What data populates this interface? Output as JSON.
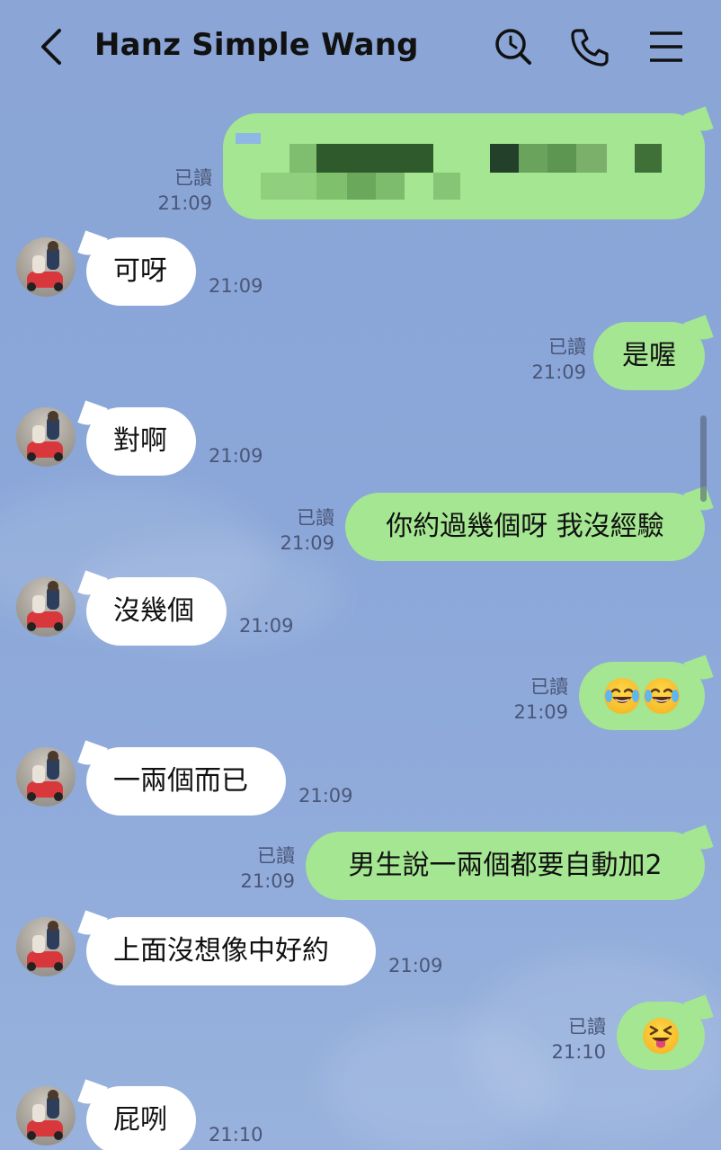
{
  "header": {
    "title": "Hanz Simple Wang",
    "back_icon": "chevron-left-icon",
    "actions": [
      "search-icon",
      "phone-icon",
      "menu-icon"
    ]
  },
  "colors": {
    "background": "#8ba7d9",
    "incoming_bubble": "#ffffff",
    "outgoing_bubble": "#a4e691"
  },
  "messages": [
    {
      "dir": "out",
      "text": "",
      "blurred": true,
      "read": "已讀",
      "time": "21:09"
    },
    {
      "dir": "in",
      "text": "可呀",
      "time": "21:09"
    },
    {
      "dir": "out",
      "text": "是喔",
      "read": "已讀",
      "time": "21:09"
    },
    {
      "dir": "in",
      "text": "對啊",
      "time": "21:09"
    },
    {
      "dir": "out",
      "text": "你約過幾個呀 我沒經驗",
      "read": "已讀",
      "time": "21:09"
    },
    {
      "dir": "in",
      "text": "沒幾個",
      "time": "21:09"
    },
    {
      "dir": "out",
      "text": "",
      "emoji": "tears-of-joy-emoji x2",
      "read": "已讀",
      "time": "21:09"
    },
    {
      "dir": "in",
      "text": "一兩個而已",
      "time": "21:09"
    },
    {
      "dir": "out",
      "text": "男生說一兩個都要自動加2",
      "read": "已讀",
      "time": "21:09"
    },
    {
      "dir": "in",
      "text": "上面沒想像中好約",
      "time": "21:09"
    },
    {
      "dir": "out",
      "text": "",
      "emoji": "tongue-out-emoji",
      "read": "已讀",
      "time": "21:10"
    },
    {
      "dir": "in",
      "text": "屁咧",
      "time": "21:10"
    }
  ]
}
